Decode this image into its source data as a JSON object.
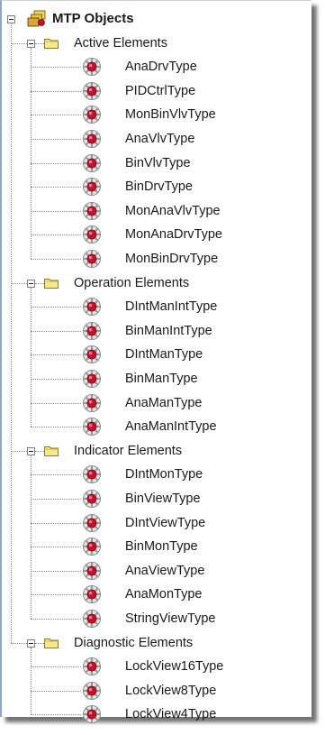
{
  "tree": {
    "root": {
      "label": "MTP Objects",
      "icon": "objects-stack-icon"
    },
    "groups": [
      {
        "label": "Active Elements",
        "items": [
          "AnaDrvType",
          "PIDCtrlType",
          "MonBinVlvType",
          "AnaVlvType",
          "BinVlvType",
          "BinDrvType",
          "MonAnaVlvType",
          "MonAnaDrvType",
          "MonBinDrvType"
        ]
      },
      {
        "label": "Operation Elements",
        "items": [
          "DIntManIntType",
          "BinManIntType",
          "DIntManType",
          "BinManType",
          "AnaManType",
          "AnaManIntType"
        ]
      },
      {
        "label": "Indicator Elements",
        "items": [
          "DIntMonType",
          "BinViewType",
          "DIntViewType",
          "BinMonType",
          "AnaViewType",
          "AnaMonType",
          "StringViewType"
        ]
      },
      {
        "label": "Diagnostic Elements",
        "items": [
          "LockView16Type",
          "LockView8Type",
          "LockView4Type"
        ]
      }
    ]
  },
  "colors": {
    "folder": "#f7e98a",
    "element_icon": "#c8102e",
    "panel_border": "#8fa6c4"
  }
}
